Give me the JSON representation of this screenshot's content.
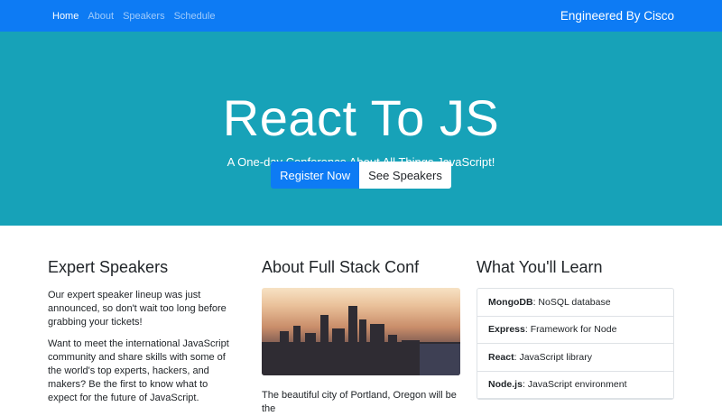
{
  "nav": {
    "links": [
      {
        "label": "Home"
      },
      {
        "label": "About"
      },
      {
        "label": "Speakers"
      },
      {
        "label": "Schedule"
      }
    ],
    "brand": "Engineered By Cisco"
  },
  "hero": {
    "title": "React To JS",
    "subtitle": "A One-day Conference About All Things JavaScript!",
    "register_button": "Register Now",
    "speakers_button": "See Speakers"
  },
  "sections": {
    "expert": {
      "heading": "Expert Speakers",
      "p1": "Our expert speaker lineup was just announced, so don't wait too long before grabbing your tickets!",
      "p2": "Want to meet the international JavaScript community and share skills with some of the world's top experts, hackers, and makers? Be the first to know what to expect for the future of JavaScript."
    },
    "about": {
      "heading": "About Full Stack Conf",
      "p1": "The beautiful city of Portland, Oregon will be the"
    },
    "learn": {
      "heading": "What You'll Learn",
      "items": [
        {
          "name": "MongoDB",
          "desc": ": NoSQL database"
        },
        {
          "name": "Express",
          "desc": ": Framework for Node"
        },
        {
          "name": "React",
          "desc": ": JavaScript library"
        },
        {
          "name": "Node.js",
          "desc": ": JavaScript environment"
        }
      ]
    }
  },
  "colors": {
    "navbar": "#0d7bf4",
    "hero": "#17a2b8",
    "primary": "#0d7bf4"
  }
}
